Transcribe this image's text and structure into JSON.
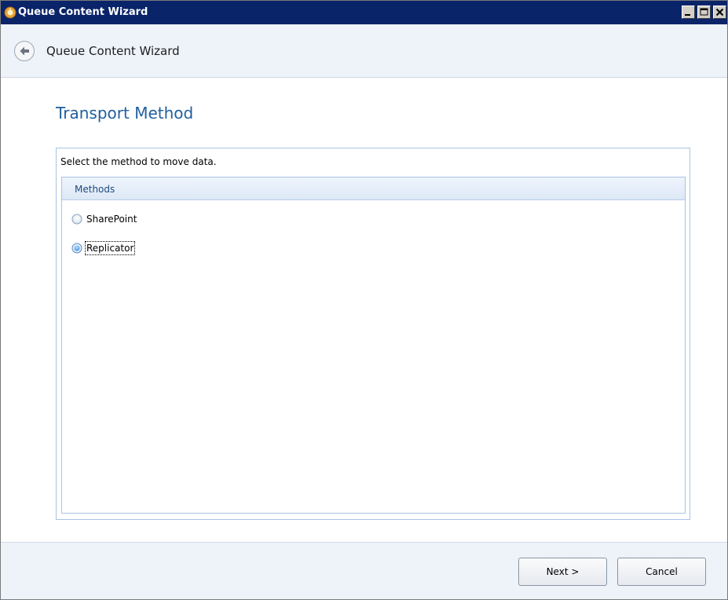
{
  "window": {
    "title": "Queue Content Wizard",
    "app_icon": "wizard-app-icon",
    "caption_buttons": [
      "minimize-icon",
      "maximize-icon",
      "close-icon"
    ]
  },
  "header": {
    "back_icon": "back-arrow-icon",
    "title": "Queue Content Wizard"
  },
  "page": {
    "section_title": "Transport Method",
    "instruction": "Select the method to move data.",
    "methods": {
      "header": "Methods",
      "options": [
        {
          "label": "SharePoint",
          "selected": false
        },
        {
          "label": "Replicator",
          "selected": true
        }
      ]
    }
  },
  "footer": {
    "next_label": "Next >",
    "cancel_label": "Cancel"
  },
  "colors": {
    "titlebar": "#0a246a",
    "accent_title": "#1f5f9f",
    "panel_border": "#a9c3e4",
    "band_background": "#eef2f9"
  }
}
